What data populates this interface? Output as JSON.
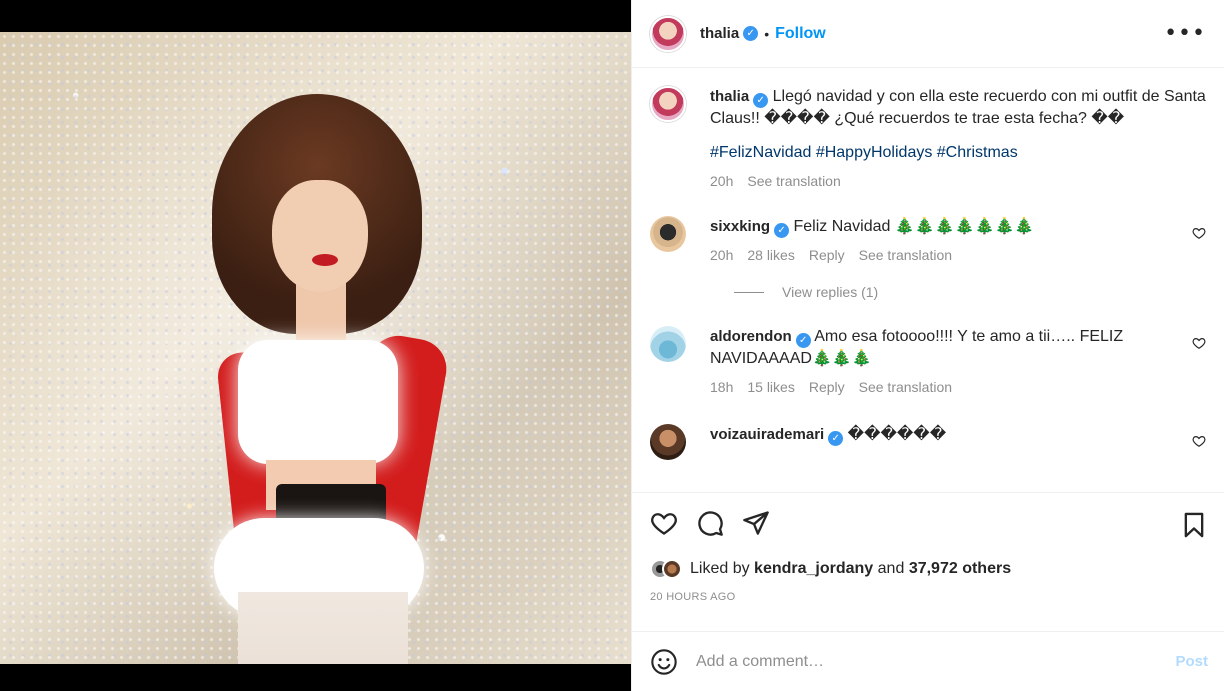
{
  "post": {
    "photo_alt": "",
    "author": "thalia",
    "follow_label": "Follow",
    "more_label": "•••",
    "verified_glyph": "✓"
  },
  "caption": {
    "username": "thalia",
    "text": "Llegó navidad y con ella este recuerdo con mi outfit de Santa Claus!! ���� ¿Qué recuerdos te trae esta fecha? ��",
    "hashtags": "#FelizNavidad #HappyHolidays #Christmas",
    "time": "20h",
    "see_translation": "See translation"
  },
  "comments": [
    {
      "username": "sixxking",
      "text": "Feliz Navidad 🎄🎄🎄🎄🎄🎄🎄",
      "time": "20h",
      "likes": "28 likes",
      "reply": "Reply",
      "see_translation": "See translation",
      "view_replies": "View replies (1)"
    },
    {
      "username": "aldorendon",
      "text": "Amo esa fotoooo!!!! Y te amo a tii….. FELIZ NAVIDAAAAD🎄🎄🎄",
      "time": "18h",
      "likes": "15 likes",
      "reply": "Reply",
      "see_translation": "See translation"
    },
    {
      "username": "voizauirademari",
      "text": "������"
    }
  ],
  "likes": {
    "prefix": "Liked by",
    "user": "kendra_jordany",
    "and": "and",
    "others": "37,972 others"
  },
  "timestamp": "20 HOURS AGO",
  "add_comment": {
    "placeholder": "Add a comment…",
    "post_label": "Post"
  },
  "colors": {
    "accent": "#0095f6",
    "verified": "#3897f0",
    "hashtag": "#00376b"
  }
}
